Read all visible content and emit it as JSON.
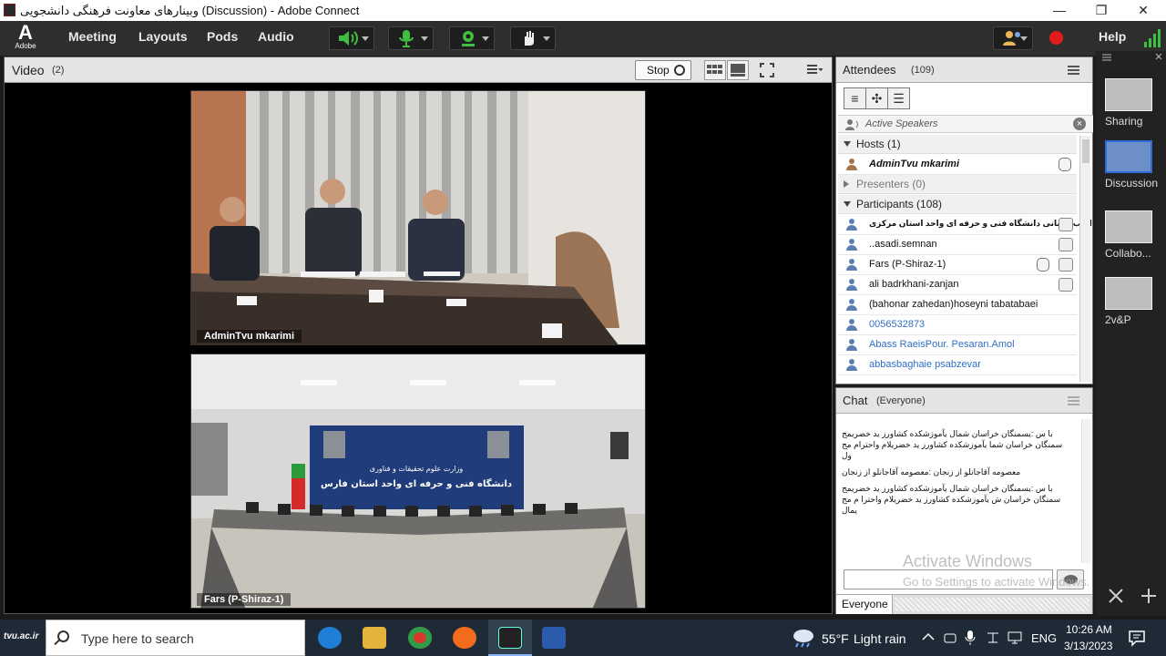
{
  "titlebar": {
    "title": "وبینارهای معاونت فرهنگی دانشجویی (Discussion) - Adobe Connect",
    "min": "—",
    "max": "❐",
    "close": "✕"
  },
  "menu": {
    "logo_mark": "A",
    "logo_text": "Adobe",
    "items": [
      "Meeting",
      "Layouts",
      "Pods",
      "Audio"
    ],
    "help": "Help"
  },
  "video_pod": {
    "title": "Video",
    "count": "(2)",
    "stop_label": "Stop",
    "feeds": [
      {
        "name": "AdminTvu mkarimi"
      },
      {
        "name": "Fars (P-Shiraz-1)"
      }
    ],
    "banner_line1": "وزارت علوم تحقیقات و فناوری",
    "banner_line2": "دانشگاه فنی و حرفه ای واحد استان فارس"
  },
  "attendees": {
    "title": "Attendees",
    "count": "(109)",
    "active_speakers": "Active Speakers",
    "groups": [
      {
        "label": "Hosts (1)"
      },
      {
        "label": "Presenters (0)"
      },
      {
        "label": "Participants (108)"
      }
    ],
    "host": "AdminTvu mkarimi",
    "participants": [
      "ایوب قربانی دانشگاه فنی و حرفه ای واحد استان مرکزی",
      "..asadi.semnan",
      "Fars (P-Shiraz-1)",
      "ali badrkhani-zanjan",
      "(bahonar zahedan)hoseyni tabatabaei",
      "0056532873",
      "Abass RaeisPour. Pesaran.Amol",
      "abbasbaghaie psabzevar"
    ]
  },
  "chat": {
    "title": "Chat",
    "scope": "(Everyone)",
    "messages": [
      "با س :یسمنگان خراسان شمال یآموزشکده کشاورز ید خضریمج سمنگان خراسان شما یآموزشکده کشاورز ید خضریلام واحترام مج ول",
      "معصومه آقاجانلو از زنجان :معصومه آقاجانلو از زنجان",
      "با س :یسمنگان خراسان شمال یآموزشکده کشاورز ید خضریمج سمنگان خراسان ش یآموزشکده کشاورز ید خضریلام واحترا م مج یمال"
    ],
    "tab": "Everyone"
  },
  "layouts": {
    "items": [
      "Sharing",
      "Discussion",
      "Collabo...",
      "2v&P"
    ]
  },
  "watermark": {
    "line1": "Activate Windows",
    "line2": "Go to Settings to activate Windows."
  },
  "taskbar": {
    "brand": "tvu.ac.ir",
    "search_placeholder": "Type here to search",
    "weather_temp": "55°F",
    "weather_text": "Light rain",
    "lang": "ENG",
    "time": "10:26 AM",
    "date": "3/13/2023"
  }
}
